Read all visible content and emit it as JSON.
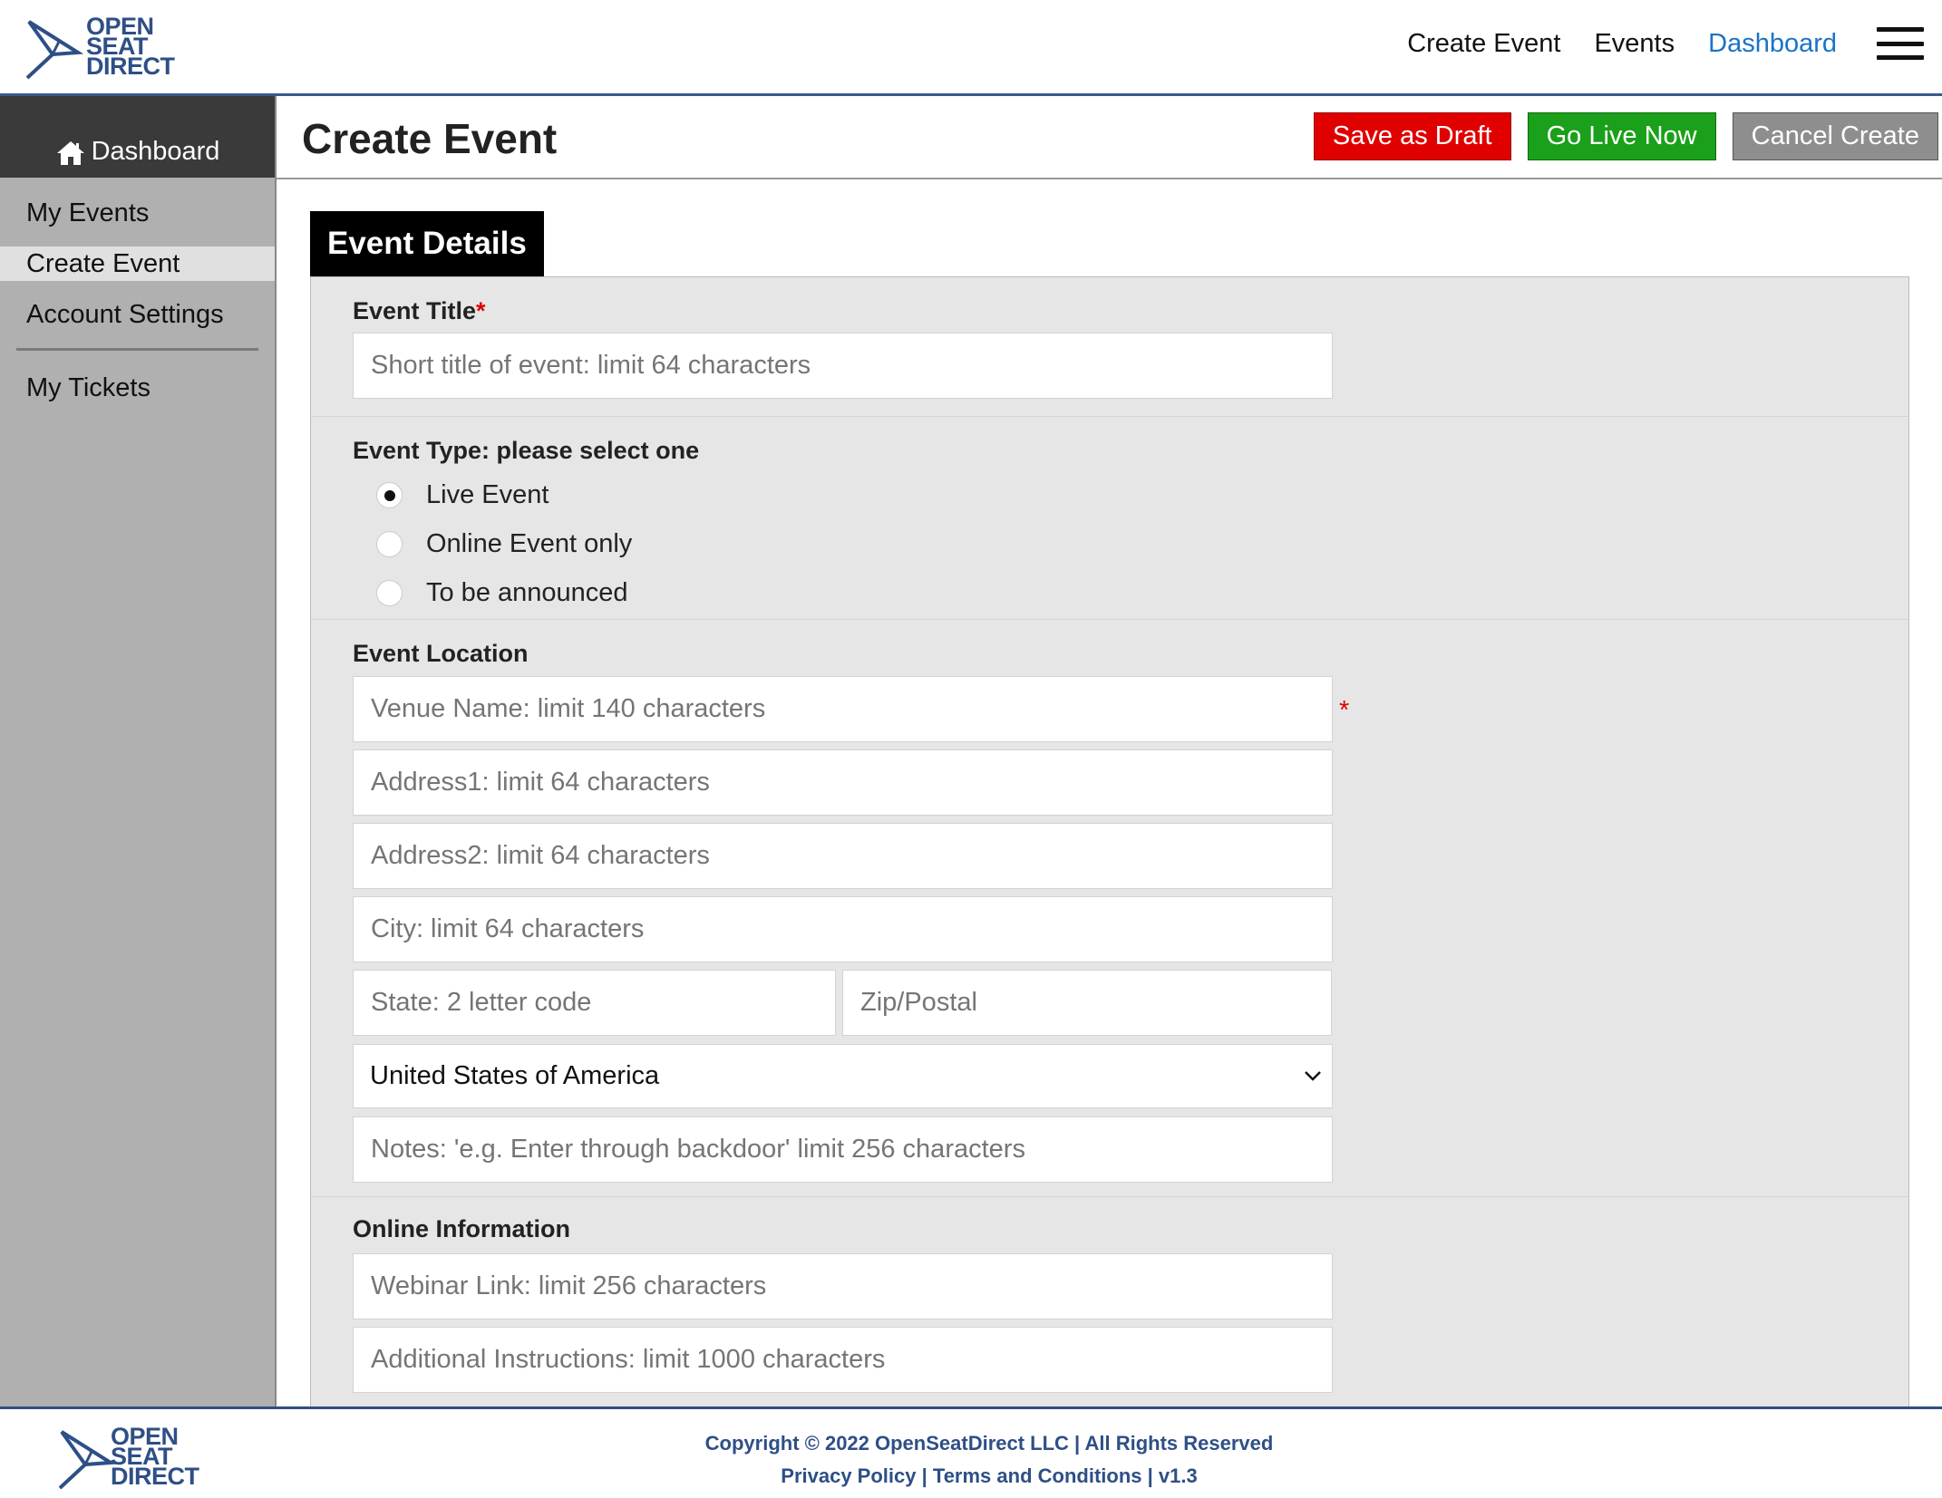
{
  "brand": {
    "line1": "OPEN",
    "line2": "SEAT",
    "line3": "DIRECT"
  },
  "nav": {
    "items": [
      {
        "label": "Create Event",
        "active": false
      },
      {
        "label": "Events",
        "active": false
      },
      {
        "label": "Dashboard",
        "active": true
      }
    ],
    "menu_icon": "hamburger-icon"
  },
  "sidebar": {
    "header": "Dashboard",
    "header_icon": "home-icon",
    "items": [
      {
        "label": "My Events"
      },
      {
        "label": "Create Event",
        "current": true
      },
      {
        "label": "Account Settings"
      },
      {
        "label": "My Tickets"
      }
    ]
  },
  "page": {
    "title": "Create Event",
    "save_draft": "Save as Draft",
    "go_live": "Go Live Now",
    "cancel": "Cancel Create"
  },
  "tab": {
    "label": "Event Details"
  },
  "form": {
    "title_label": "Event Title",
    "required_mark": "*",
    "title_placeholder": "Short title of event: limit 64 characters",
    "type_label": "Event Type: please select one",
    "types": [
      {
        "label": "Live Event",
        "selected": true
      },
      {
        "label": "Online Event only",
        "selected": false
      },
      {
        "label": "To be announced",
        "selected": false
      }
    ],
    "location_label": "Event Location",
    "venue_placeholder": "Venue Name: limit 140 characters",
    "address1_placeholder": "Address1: limit 64 characters",
    "address2_placeholder": "Address2: limit 64 characters",
    "city_placeholder": "City: limit 64 characters",
    "state_placeholder": "State: 2 letter code",
    "zip_placeholder": "Zip/Postal",
    "country_value": "United States of America",
    "notes_placeholder": "Notes: 'e.g. Enter through backdoor' limit 256 characters",
    "online_label": "Online Information",
    "webinar_placeholder": "Webinar Link: limit 256 characters",
    "instructions_placeholder": "Additional Instructions: limit 1000 characters"
  },
  "footer": {
    "copyright": "Copyright © 2022 OpenSeatDirect LLC | All Rights Reserved",
    "privacy": "Privacy Policy",
    "sep1": " | ",
    "terms": "Terms and Conditions",
    "sep2": " | ",
    "version": "v1.3"
  },
  "colors": {
    "brand_blue": "#2e4f86",
    "active_nav": "#1a73c9",
    "draft_red": "#e00000",
    "live_green": "#1aa01a",
    "cancel_gray": "#8e8e8e"
  }
}
